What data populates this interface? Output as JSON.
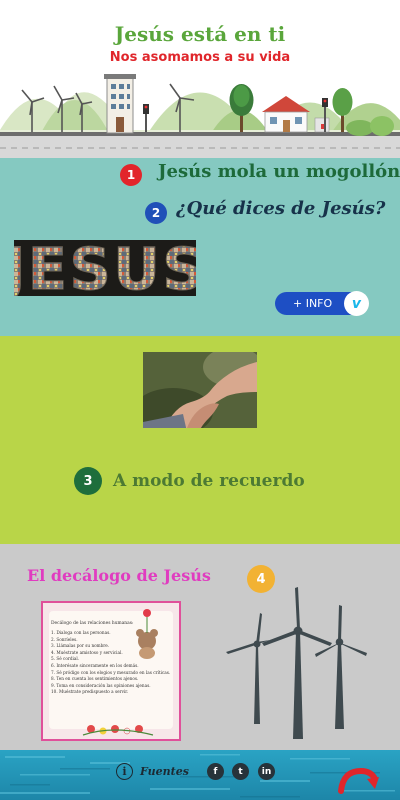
{
  "header": {
    "title": "Jesús está en ti",
    "subtitle": "Nos asomamos a su vida"
  },
  "section1": {
    "badge1": "1",
    "heading1": "Jesús mola un mogollón",
    "badge2": "2",
    "heading2": "¿Qué dices de Jesús?",
    "image_text": "JESUS",
    "info_button": "+ INFO",
    "vimeo_icon": "v"
  },
  "section2": {
    "badge3": "3",
    "heading3": "A modo de recuerdo"
  },
  "section3": {
    "heading4": "El decálogo de Jesús",
    "badge4": "4",
    "decalogo_title": "Decálogo de las relaciones humanas:",
    "decalogo_items": [
      "1. Dialoga con las personas.",
      "2. Sonríeles.",
      "3. Llámalas por su nombre.",
      "4. Muéstrate amistoso y servicial.",
      "5. Sé cordial.",
      "6. Interésate sinceramente en los demás.",
      "7. Sé pródigo con los elogios y mesurado en las críticas.",
      "8. Ten en cuenta los sentimientos ajenos.",
      "9. Toma en consideración las opiniones ajenas.",
      "10. Muéstrate predispuesto a servir."
    ]
  },
  "footer": {
    "info_icon": "i",
    "sources_label": "Fuentes",
    "facebook": "f",
    "twitter": "t",
    "linkedin": "in"
  },
  "colors": {
    "header_title": "#5aa63b",
    "header_subtitle": "#e0262b",
    "section1_bg": "#85c9c1",
    "section2_bg": "#b9d548",
    "section3_bg": "#cacaca",
    "footer_bg": "#2aa3c4",
    "badge1": "#e2252b",
    "badge2": "#2050b8",
    "badge3": "#1e6e3c",
    "badge4": "#f2b233",
    "decalogo_heading": "#e03cc0"
  }
}
